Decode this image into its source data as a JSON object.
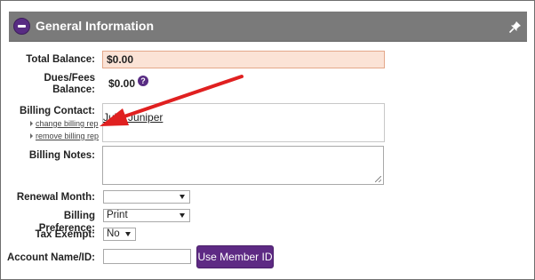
{
  "section": {
    "title": "General Information",
    "collapse_icon": "minus-circle-icon",
    "pin_icon": "pin-icon"
  },
  "fields": {
    "total_balance": {
      "label": "Total Balance:",
      "value": "$0.00"
    },
    "dues_fees_balance": {
      "label_line1": "Dues/Fees",
      "label_line2": "Balance:",
      "value": "$0.00",
      "help_icon": "?"
    },
    "billing_contact": {
      "label": "Billing Contact:",
      "value": "Julie Juniper",
      "change_link": "change billing rep",
      "remove_link": "remove billing rep"
    },
    "billing_notes": {
      "label": "Billing Notes:",
      "value": ""
    },
    "renewal_month": {
      "label": "Renewal Month:",
      "value": ""
    },
    "billing_preference": {
      "label": "Billing Preference:",
      "value": "Print"
    },
    "tax_exempt": {
      "label": "Tax Exempt:",
      "value": "No"
    },
    "account_name_id": {
      "label": "Account Name/ID:",
      "value": "",
      "button_label": "Use Member ID"
    }
  },
  "colors": {
    "header_bg": "#7a7a7a",
    "brand_purple": "#582c83",
    "balance_bg": "#fbe3d6",
    "annotation_arrow": "#e02020"
  }
}
